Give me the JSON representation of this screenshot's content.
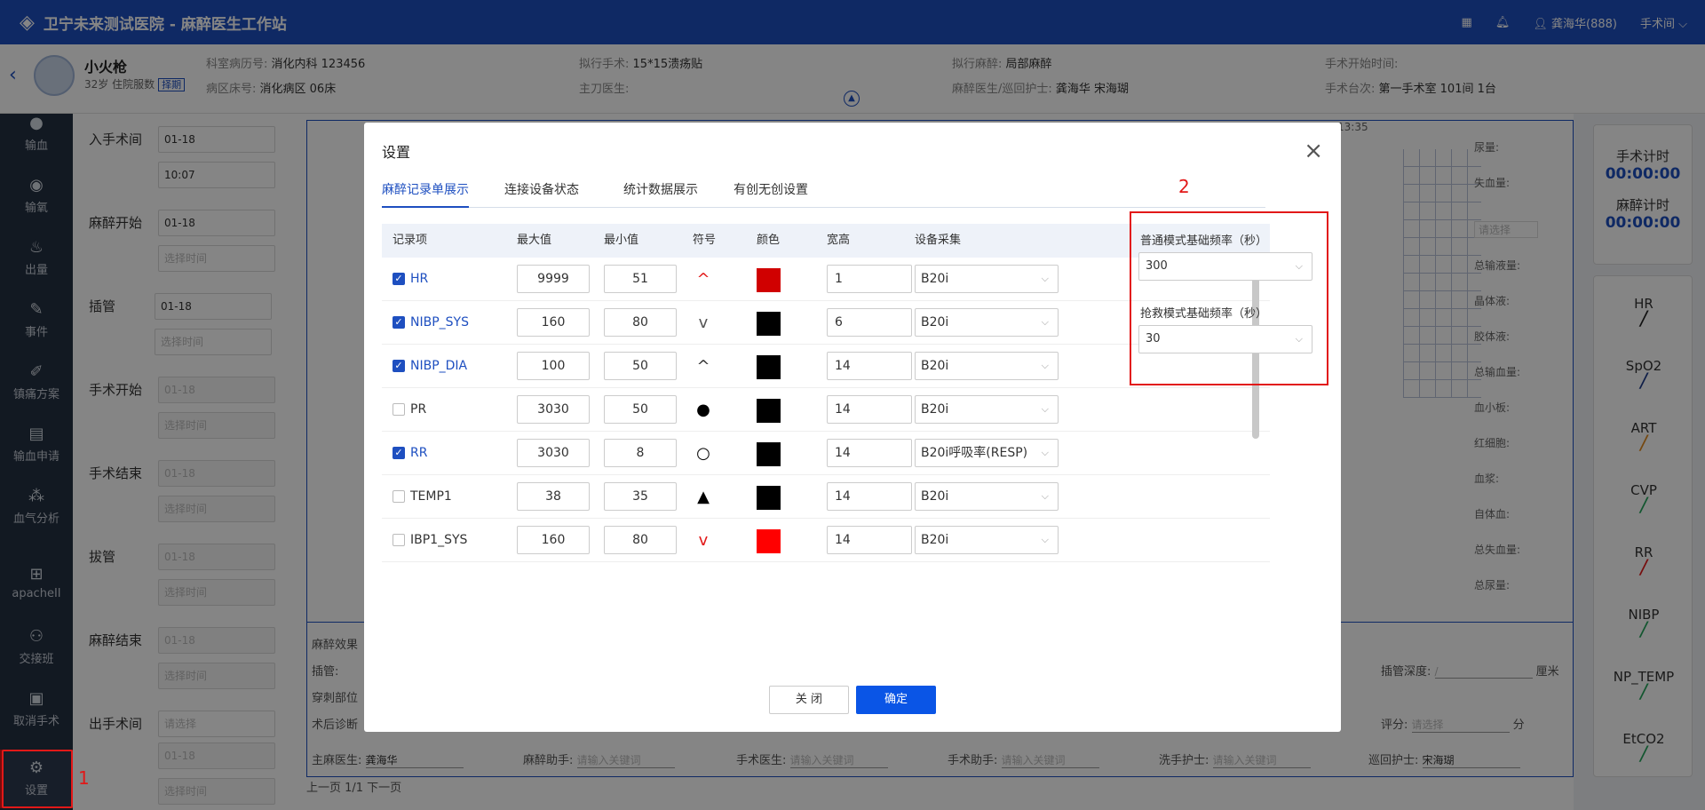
{
  "app": {
    "logo_icon": "hospital-logo-icon",
    "title": "卫宁未来测试医院 - 麻醉医生工作站",
    "user": "龚海华(888)",
    "room": "手术间"
  },
  "patient": {
    "name": "小火枪",
    "meta": "32岁 住院服数",
    "tag": "择期",
    "dept_label": "科室病历号:",
    "dept_value": "消化内科 123456",
    "ward_label": "病区床号:",
    "ward_value": "消化病区 06床",
    "surgery_label": "拟行手术:",
    "surgery_value": "15*15溃疡贴",
    "surgeon_label": "主刀医生:",
    "surgeon_value": "",
    "anes_label": "拟行麻醉:",
    "anes_value": "局部麻醉",
    "anes_doctor_label": "麻醉医生/巡回护士:",
    "anes_doctor_value": "龚海华 宋海瑚",
    "start_label": "手术开始时间:",
    "start_value": "",
    "room_label": "手术台次:",
    "room_value": "第一手术室 101间 1台"
  },
  "sidebar": {
    "items": [
      {
        "label": "输血",
        "icon": "drop-icon"
      },
      {
        "label": "输氧",
        "icon": "oxygen-icon"
      },
      {
        "label": "出量",
        "icon": "output-icon"
      },
      {
        "label": "事件",
        "icon": "event-icon"
      },
      {
        "label": "镇痛方案",
        "icon": "analgesia-icon"
      },
      {
        "label": "输血申请",
        "icon": "blood-request-icon"
      },
      {
        "label": "血气分析",
        "icon": "blood-gas-icon"
      },
      {
        "label": "apacheII",
        "icon": "apache-icon"
      },
      {
        "label": "交接班",
        "icon": "handover-icon"
      },
      {
        "label": "取消手术",
        "icon": "cancel-surgery-icon"
      },
      {
        "label": "设置",
        "icon": "gear-icon"
      }
    ],
    "annotation": "1"
  },
  "timeline": {
    "rows": [
      {
        "label": "入手术间",
        "v1": "01-18",
        "v2": "10:07"
      },
      {
        "label": "麻醉开始",
        "v1": "01-18",
        "v2": "选择时间"
      },
      {
        "label": "插管",
        "v1": "01-18",
        "v2": "选择时间"
      },
      {
        "label": "手术开始",
        "v1": "01-18",
        "v2": "选择时间"
      },
      {
        "label": "手术结束",
        "v1": "01-18",
        "v2": "选择时间"
      },
      {
        "label": "拔管",
        "v1": "01-18",
        "v2": "选择时间"
      },
      {
        "label": "麻醉结束",
        "v1": "01-18",
        "v2": "选择时间"
      },
      {
        "label": "出手术间",
        "v1": "请选择",
        "v2": "01-18",
        "v3": "选择时间"
      }
    ]
  },
  "chart_bg": {
    "time": "13:35",
    "side_fields": [
      "尿量:",
      "失血量:",
      "请选择",
      "总输液量:",
      "晶体液:",
      "胶体液:",
      "总输血量:",
      "血小板:",
      "红细胞:",
      "血浆:",
      "自体血:",
      "总失血量:",
      "总尿量:"
    ],
    "bottom": {
      "row1": "麻醉效果",
      "intubate": "插管:",
      "puncture": "穿刺部位",
      "postdiag": "术后诊断",
      "depth": "插管深度:",
      "cm": "厘米",
      "score": "评分:",
      "score_ph": "请选择",
      "score_unit": "分",
      "chief_anes": "主麻医生:",
      "chief_anes_v": "龚海华",
      "anes_assist": "麻醉助手:",
      "surgeon": "手术医生:",
      "surgery_assist": "手术助手:",
      "scrub_nurse": "洗手护士:",
      "circ_nurse": "巡回护士:",
      "circ_nurse_v": "宋海瑚",
      "keyword_ph": "请输入关键词"
    },
    "pager": "上一页 1/1 下一页"
  },
  "timers": {
    "surgery_label": "手术计时",
    "surgery_value": "00:00:00",
    "anes_label": "麻醉计时",
    "anes_value": "00:00:00"
  },
  "vitals": [
    "HR",
    "SpO2",
    "ART",
    "CVP",
    "RR",
    "NIBP",
    "NP_TEMP",
    "EtCO2"
  ],
  "vital_colors": [
    "#222222",
    "#1e3a8a",
    "#e08a1e",
    "#23a55a",
    "#e21818",
    "#23a55a",
    "#23a55a",
    "#23a55a"
  ],
  "dialog": {
    "title": "设置",
    "tabs": [
      "麻醉记录单展示",
      "连接设备状态",
      "统计数据展示",
      "有创无创设置"
    ],
    "columns": [
      "记录项",
      "最大值",
      "最小值",
      "符号",
      "颜色",
      "宽高",
      "设备采集"
    ],
    "rows": [
      {
        "checked": true,
        "name": "HR",
        "max": "9999",
        "min": "51",
        "symbol": "^",
        "symbol_color": "#e21818",
        "color": "#d00000",
        "wh": "1",
        "device": "B20i"
      },
      {
        "checked": true,
        "name": "NIBP_SYS",
        "max": "160",
        "min": "80",
        "symbol": "v",
        "symbol_color": "#555555",
        "color": "#000000",
        "wh": "6",
        "device": "B20i"
      },
      {
        "checked": true,
        "name": "NIBP_DIA",
        "max": "100",
        "min": "50",
        "symbol": "^",
        "symbol_color": "#333333",
        "color": "#000000",
        "wh": "14",
        "device": "B20i"
      },
      {
        "checked": false,
        "name": "PR",
        "max": "3030",
        "min": "50",
        "symbol": "●",
        "symbol_color": "#000000",
        "color": "#000000",
        "wh": "14",
        "device": "B20i"
      },
      {
        "checked": true,
        "name": "RR",
        "max": "3030",
        "min": "8",
        "symbol": "○",
        "symbol_color": "#000000",
        "color": "#000000",
        "wh": "14",
        "device": "B20i呼吸率(RESP)"
      },
      {
        "checked": false,
        "name": "TEMP1",
        "max": "38",
        "min": "35",
        "symbol": "▲",
        "symbol_color": "#000000",
        "color": "#000000",
        "wh": "14",
        "device": "B20i"
      },
      {
        "checked": false,
        "name": "IBP1_SYS",
        "max": "160",
        "min": "80",
        "symbol": "v",
        "symbol_color": "#e21818",
        "color": "#ff0000",
        "wh": "14",
        "device": "B20i"
      }
    ],
    "freq": {
      "normal_label": "普通模式基础频率（秒）",
      "normal_value": "300",
      "rescue_label": "抢救模式基础频率（秒）",
      "rescue_value": "30",
      "annotation": "2"
    },
    "close_label": "关 闭",
    "ok_label": "确定"
  }
}
